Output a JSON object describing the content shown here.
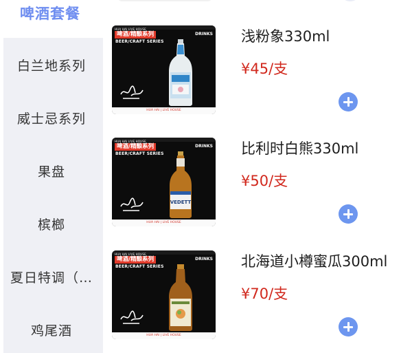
{
  "sidebar": {
    "categories": [
      {
        "label": "啤酒套餐",
        "active": true
      },
      {
        "label": "白兰地系列",
        "active": false
      },
      {
        "label": "威士忌系列",
        "active": false
      },
      {
        "label": "果盘",
        "active": false
      },
      {
        "label": "槟榔",
        "active": false
      },
      {
        "label": "夏日特调（…",
        "active": false
      },
      {
        "label": "鸡尾酒",
        "active": false
      }
    ]
  },
  "colors": {
    "accent": "#6f8ef0",
    "price": "#d1281d",
    "add_button": "#6d96ef",
    "sidebar_bg": "#eff0f5",
    "tag_red": "#e23b2b"
  },
  "products": [
    {
      "name": "浅粉象330ml",
      "price": "¥45/支",
      "thumb": {
        "top_text": "HUA HAI LIVE HOUSE",
        "tag": "啤酒/精酿系列",
        "sub": "BEER/CRAFT SERIES",
        "drinks": "DRINKS",
        "footer": "HUA HAI | LIVE HOUSE",
        "bottle_icon": "pink-elephant-bottle-icon"
      }
    },
    {
      "name": "比利时白熊330ml",
      "price": "¥50/支",
      "thumb": {
        "top_text": "HUA HAI LIVE HOUSE",
        "tag": "啤酒/精酿系列",
        "sub": "BEER/CRAFT SERIES",
        "drinks": "DRINKS",
        "footer": "HUA HAI | LIVE HOUSE",
        "bottle_label": "VEDETT",
        "bottle_icon": "vedett-bottle-icon"
      }
    },
    {
      "name": "北海道小樽蜜瓜300ml",
      "price": "¥70/支",
      "thumb": {
        "top_text": "HUA HAI LIVE HOUSE",
        "tag": "啤酒/精酿系列",
        "sub": "BEER/CRAFT SERIES",
        "drinks": "DRINKS",
        "footer": "HUA HAI | LIVE HOUSE",
        "bottle_icon": "melon-beer-bottle-icon"
      }
    }
  ]
}
